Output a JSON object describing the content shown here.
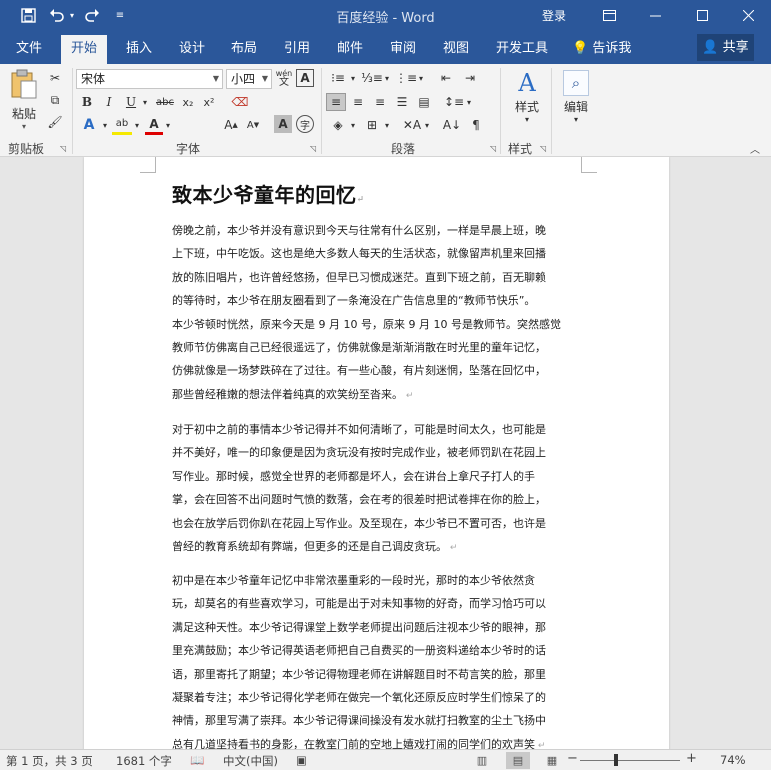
{
  "titlebar": {
    "title": "百度经验 - Word",
    "login": "登录",
    "icons": [
      "save-icon",
      "undo-icon",
      "redo-icon",
      "customize-qat-icon"
    ]
  },
  "tabs": [
    {
      "label": "文件"
    },
    {
      "label": "开始"
    },
    {
      "label": "插入"
    },
    {
      "label": "设计"
    },
    {
      "label": "布局"
    },
    {
      "label": "引用"
    },
    {
      "label": "邮件"
    },
    {
      "label": "审阅"
    },
    {
      "label": "视图"
    },
    {
      "label": "开发工具"
    }
  ],
  "tellme": "告诉我",
  "share": "共享",
  "ribbon": {
    "clipboard": {
      "paste": "粘贴",
      "label": "剪贴板"
    },
    "font": {
      "name": "宋体",
      "size": "小四",
      "label": "字体",
      "wen_icon": "wén"
    },
    "paragraph": {
      "label": "段落"
    },
    "styles": {
      "style_btn": "样式",
      "label": "样式"
    },
    "editing": {
      "edit_btn": "编辑"
    }
  },
  "document": {
    "title": "致本少爷童年的回忆",
    "paragraphs": [
      [
        "傍晚之前，本少爷并没有意识到今天与往常有什么区别，一样是早晨上班，晚",
        "上下班，中午吃饭。这也是绝大多数人每天的生活状态，就像留声机里来回播",
        "放的陈旧唱片，也许曾经悠扬，但早已习惯成迷茫。直到下班之前，百无聊赖",
        "的等待时，本少爷在朋友圈看到了一条淹没在广告信息里的“教师节快乐”。",
        "本少爷顿时恍然，原来今天是 9 月 10 号，原来 9 月 10 号是教师节。突然感觉",
        "教师节仿佛离自己已经很遥远了，仿佛就像是渐渐消散在时光里的童年记忆，",
        "仿佛就像是一场梦跌碎在了过往。有一些心酸，有片刻迷惘，坠落在回忆中，",
        "那些曾经稚嫩的想法伴着纯真的欢笑纷至沓来。"
      ],
      [
        "对于初中之前的事情本少爷记得并不如何清晰了，可能是时间太久，也可能是",
        "并不美好，唯一的印象便是因为贪玩没有按时完成作业，被老师罚趴在花园上",
        "写作业。那时候，感觉全世界的老师都是坏人，会在讲台上拿尺子打人的手",
        "掌，会在回答不出问题时气愤的数落，会在考的很差时把试卷摔在你的脸上，",
        "也会在放学后罚你趴在花园上写作业。及至现在，本少爷已不置可否，也许是",
        "曾经的教育系统却有弊端，但更多的还是自己调皮贪玩。"
      ],
      [
        "初中是在本少爷童年记忆中非常浓墨重彩的一段时光，那时的本少爷依然贪",
        "玩，却莫名的有些喜欢学习，可能是出于对未知事物的好奇，而学习恰巧可以",
        "满足这种天性。本少爷记得课堂上数学老师提出问题后注视本少爷的眼神，那",
        "里充满鼓励；本少爷记得英语老师把自己自费买的一册资料递给本少爷时的话",
        "语，那里寄托了期望；本少爷记得物理老师在讲解题目时不苟言笑的脸，那里",
        "凝聚着专注；本少爷记得化学老师在做完一个氧化还原反应时学生们惊呆了的",
        "神情，那里写满了崇拜。本少爷记得课间操没有发水就打扫教室的尘土飞扬中",
        "总有几道坚持看书的身影，在教室门前的空地上嬉戏打闹的同学们的欢声笑"
      ]
    ]
  },
  "statusbar": {
    "page": "第 1 页，共 3 页",
    "words": "1681 个字",
    "language": "中文(中国)",
    "zoom": "74%",
    "zoom_level": 74
  }
}
